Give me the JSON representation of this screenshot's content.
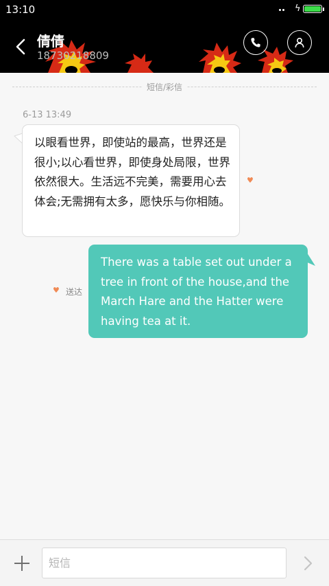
{
  "status_bar": {
    "time": "13:10",
    "battery_color": "#3ddc4a"
  },
  "header": {
    "contact_name": "倩倩",
    "contact_number": "18730218809",
    "back_icon": "chevron-left-icon",
    "call_icon": "phone-icon",
    "contact_icon": "person-icon"
  },
  "conversation": {
    "separator_label": "短信/彩信",
    "timestamp": "6-13 13:49",
    "incoming_message": "以眼看世界，即使站的最高，世界还是很小;以心看世界，即使身处局限，世界依然很大。生活远不完美，需要用心去体会;无需拥有太多，愿快乐与你相随。",
    "outgoing_message": "There was a table set out under a tree in front of the house,and the March Hare and the Hatter were having tea at it.",
    "outgoing_status": "送达",
    "outgoing_bubble_color": "#52c8b8",
    "heart_glyph": "♥",
    "heart_color": "#f08a55"
  },
  "compose": {
    "placeholder": "短信",
    "value": "",
    "add_icon": "plus-icon",
    "send_icon": "chevron-right-icon"
  }
}
